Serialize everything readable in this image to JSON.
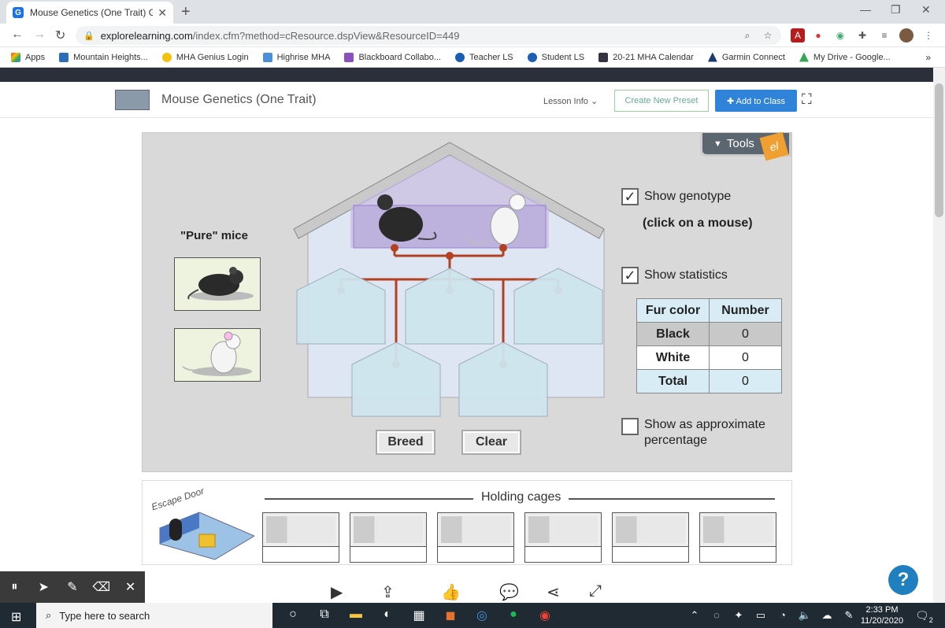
{
  "browser": {
    "tab_title": "Mouse Genetics (One Trait) Gizmo",
    "tab_favicon": "G",
    "new_tab": "+",
    "url_host": "explorelearning.com",
    "url_path": "/index.cfm?method=cResource.dspView&ResourceID=449",
    "minimize": "—",
    "maximize": "❐",
    "close": "✕",
    "back": "←",
    "forward": "→",
    "reload": "↻"
  },
  "bookmarks": [
    {
      "label": "Apps",
      "color": "#e94235"
    },
    {
      "label": "Mountain Heights...",
      "color": "#2a6ebb"
    },
    {
      "label": "MHA Genius Login",
      "color": "#f4c20d"
    },
    {
      "label": "Highrise MHA",
      "color": "#4a90d9"
    },
    {
      "label": "Blackboard Collabo...",
      "color": "#8a4fc1"
    },
    {
      "label": "Teacher LS",
      "color": "#1a5fb4"
    },
    {
      "label": "Student LS",
      "color": "#1a5fb4"
    },
    {
      "label": "20-21 MHA Calendar",
      "color": "#334"
    },
    {
      "label": "Garmin Connect",
      "color": "#1b3b6f"
    },
    {
      "label": "My Drive - Google...",
      "color": "#34a853"
    }
  ],
  "bookmarks_more": "»",
  "app": {
    "title": "Mouse Genetics (One Trait)",
    "lesson_info": "Lesson Info",
    "create_preset": "Create New Preset",
    "add_to_class": "✚ Add to Class",
    "fullscreen": "⛶"
  },
  "gizmo": {
    "tools": "Tools",
    "tools_logo": "el",
    "pure_mice": "\"Pure\" mice",
    "show_genotype": "Show genotype",
    "click_mouse": "(click on a mouse)",
    "show_statistics": "Show statistics",
    "show_percentage_1": "Show as approximate",
    "show_percentage_2": "percentage",
    "genotype_checked": true,
    "statistics_checked": true,
    "percentage_checked": false,
    "check_mark": "✓",
    "breed": "Breed",
    "clear": "Clear",
    "stats": {
      "col1": "Fur color",
      "col2": "Number",
      "rows": [
        {
          "label": "Black",
          "value": "0"
        },
        {
          "label": "White",
          "value": "0"
        },
        {
          "label": "Total",
          "value": "0"
        }
      ]
    }
  },
  "holding": {
    "title": "Holding cages",
    "escape": "Escape Door",
    "cage_count": 6
  },
  "controls": {
    "pause": "⏸",
    "pointer": "➤",
    "pen": "✎",
    "eraser": "⌫",
    "close": "✕"
  },
  "help": "?",
  "taskbar": {
    "search_placeholder": "Type here to search",
    "time": "2:33 PM",
    "date": "11/20/2020",
    "notifications": "2"
  }
}
